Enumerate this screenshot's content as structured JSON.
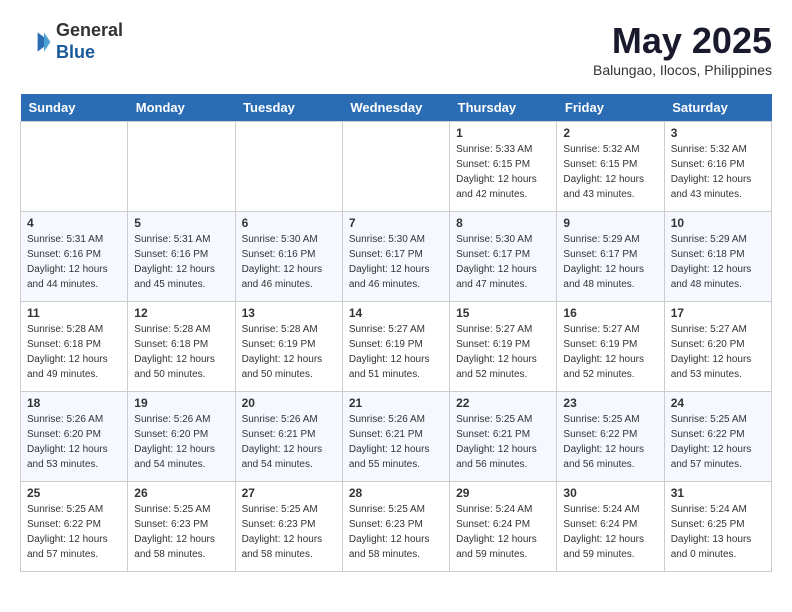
{
  "header": {
    "logo_line1": "General",
    "logo_line2": "Blue",
    "month": "May 2025",
    "location": "Balungao, Ilocos, Philippines"
  },
  "weekdays": [
    "Sunday",
    "Monday",
    "Tuesday",
    "Wednesday",
    "Thursday",
    "Friday",
    "Saturday"
  ],
  "weeks": [
    [
      {
        "day": "",
        "info": ""
      },
      {
        "day": "",
        "info": ""
      },
      {
        "day": "",
        "info": ""
      },
      {
        "day": "",
        "info": ""
      },
      {
        "day": "1",
        "info": "Sunrise: 5:33 AM\nSunset: 6:15 PM\nDaylight: 12 hours\nand 42 minutes."
      },
      {
        "day": "2",
        "info": "Sunrise: 5:32 AM\nSunset: 6:15 PM\nDaylight: 12 hours\nand 43 minutes."
      },
      {
        "day": "3",
        "info": "Sunrise: 5:32 AM\nSunset: 6:16 PM\nDaylight: 12 hours\nand 43 minutes."
      }
    ],
    [
      {
        "day": "4",
        "info": "Sunrise: 5:31 AM\nSunset: 6:16 PM\nDaylight: 12 hours\nand 44 minutes."
      },
      {
        "day": "5",
        "info": "Sunrise: 5:31 AM\nSunset: 6:16 PM\nDaylight: 12 hours\nand 45 minutes."
      },
      {
        "day": "6",
        "info": "Sunrise: 5:30 AM\nSunset: 6:16 PM\nDaylight: 12 hours\nand 46 minutes."
      },
      {
        "day": "7",
        "info": "Sunrise: 5:30 AM\nSunset: 6:17 PM\nDaylight: 12 hours\nand 46 minutes."
      },
      {
        "day": "8",
        "info": "Sunrise: 5:30 AM\nSunset: 6:17 PM\nDaylight: 12 hours\nand 47 minutes."
      },
      {
        "day": "9",
        "info": "Sunrise: 5:29 AM\nSunset: 6:17 PM\nDaylight: 12 hours\nand 48 minutes."
      },
      {
        "day": "10",
        "info": "Sunrise: 5:29 AM\nSunset: 6:18 PM\nDaylight: 12 hours\nand 48 minutes."
      }
    ],
    [
      {
        "day": "11",
        "info": "Sunrise: 5:28 AM\nSunset: 6:18 PM\nDaylight: 12 hours\nand 49 minutes."
      },
      {
        "day": "12",
        "info": "Sunrise: 5:28 AM\nSunset: 6:18 PM\nDaylight: 12 hours\nand 50 minutes."
      },
      {
        "day": "13",
        "info": "Sunrise: 5:28 AM\nSunset: 6:19 PM\nDaylight: 12 hours\nand 50 minutes."
      },
      {
        "day": "14",
        "info": "Sunrise: 5:27 AM\nSunset: 6:19 PM\nDaylight: 12 hours\nand 51 minutes."
      },
      {
        "day": "15",
        "info": "Sunrise: 5:27 AM\nSunset: 6:19 PM\nDaylight: 12 hours\nand 52 minutes."
      },
      {
        "day": "16",
        "info": "Sunrise: 5:27 AM\nSunset: 6:19 PM\nDaylight: 12 hours\nand 52 minutes."
      },
      {
        "day": "17",
        "info": "Sunrise: 5:27 AM\nSunset: 6:20 PM\nDaylight: 12 hours\nand 53 minutes."
      }
    ],
    [
      {
        "day": "18",
        "info": "Sunrise: 5:26 AM\nSunset: 6:20 PM\nDaylight: 12 hours\nand 53 minutes."
      },
      {
        "day": "19",
        "info": "Sunrise: 5:26 AM\nSunset: 6:20 PM\nDaylight: 12 hours\nand 54 minutes."
      },
      {
        "day": "20",
        "info": "Sunrise: 5:26 AM\nSunset: 6:21 PM\nDaylight: 12 hours\nand 54 minutes."
      },
      {
        "day": "21",
        "info": "Sunrise: 5:26 AM\nSunset: 6:21 PM\nDaylight: 12 hours\nand 55 minutes."
      },
      {
        "day": "22",
        "info": "Sunrise: 5:25 AM\nSunset: 6:21 PM\nDaylight: 12 hours\nand 56 minutes."
      },
      {
        "day": "23",
        "info": "Sunrise: 5:25 AM\nSunset: 6:22 PM\nDaylight: 12 hours\nand 56 minutes."
      },
      {
        "day": "24",
        "info": "Sunrise: 5:25 AM\nSunset: 6:22 PM\nDaylight: 12 hours\nand 57 minutes."
      }
    ],
    [
      {
        "day": "25",
        "info": "Sunrise: 5:25 AM\nSunset: 6:22 PM\nDaylight: 12 hours\nand 57 minutes."
      },
      {
        "day": "26",
        "info": "Sunrise: 5:25 AM\nSunset: 6:23 PM\nDaylight: 12 hours\nand 58 minutes."
      },
      {
        "day": "27",
        "info": "Sunrise: 5:25 AM\nSunset: 6:23 PM\nDaylight: 12 hours\nand 58 minutes."
      },
      {
        "day": "28",
        "info": "Sunrise: 5:25 AM\nSunset: 6:23 PM\nDaylight: 12 hours\nand 58 minutes."
      },
      {
        "day": "29",
        "info": "Sunrise: 5:24 AM\nSunset: 6:24 PM\nDaylight: 12 hours\nand 59 minutes."
      },
      {
        "day": "30",
        "info": "Sunrise: 5:24 AM\nSunset: 6:24 PM\nDaylight: 12 hours\nand 59 minutes."
      },
      {
        "day": "31",
        "info": "Sunrise: 5:24 AM\nSunset: 6:25 PM\nDaylight: 13 hours\nand 0 minutes."
      }
    ]
  ]
}
